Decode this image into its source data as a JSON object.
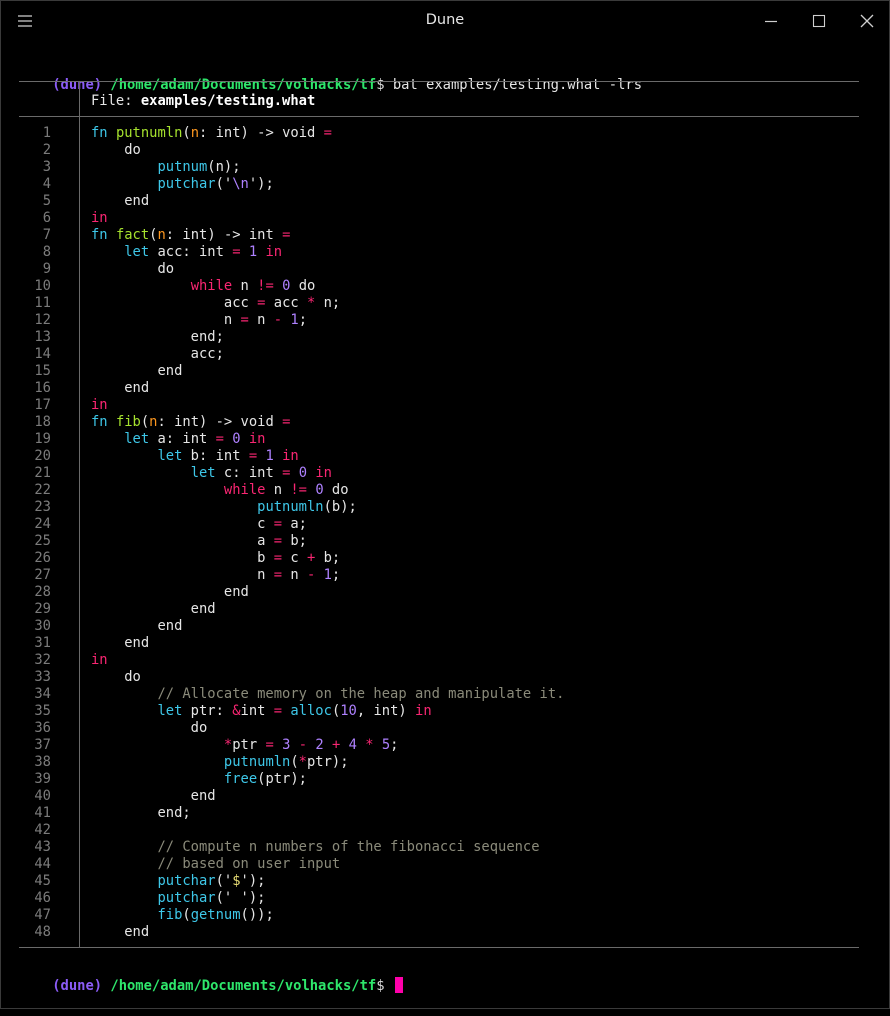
{
  "window": {
    "title": "Dune",
    "menu_icon": "hamburger-icon",
    "controls": [
      "minimize-icon",
      "maximize-icon",
      "close-icon"
    ]
  },
  "prompt": {
    "env": "(dune)",
    "path": "/home/adam/Documents/volhacks/tf",
    "symbol": "$",
    "command": "bat examples/testing.what -lrs"
  },
  "bat": {
    "file_label": "File: ",
    "file_name": "examples/testing.what"
  },
  "code_lines": [
    [
      [
        "fn",
        "k-fn"
      ],
      [
        " "
      ],
      [
        "putnumln",
        "k-name"
      ],
      [
        "("
      ],
      [
        "n",
        "k-param"
      ],
      [
        ": int) -> void "
      ],
      [
        "=",
        "k-op"
      ]
    ],
    [
      [
        "    do"
      ]
    ],
    [
      [
        "        "
      ],
      [
        "putnum",
        "k-call"
      ],
      [
        "(n);"
      ]
    ],
    [
      [
        "        "
      ],
      [
        "putchar",
        "k-call"
      ],
      [
        "('"
      ],
      [
        "\\n",
        "k-esc"
      ],
      [
        "');"
      ]
    ],
    [
      [
        "    end"
      ]
    ],
    [
      [
        "in",
        "k-op"
      ]
    ],
    [
      [
        "fn",
        "k-fn"
      ],
      [
        " "
      ],
      [
        "fact",
        "k-name"
      ],
      [
        "("
      ],
      [
        "n",
        "k-param"
      ],
      [
        ": int) -> int "
      ],
      [
        "=",
        "k-op"
      ]
    ],
    [
      [
        "    "
      ],
      [
        "let",
        "k-fn"
      ],
      [
        " acc: int "
      ],
      [
        "=",
        "k-op"
      ],
      [
        " "
      ],
      [
        "1",
        "k-num"
      ],
      [
        " "
      ],
      [
        "in",
        "k-op"
      ]
    ],
    [
      [
        "        do"
      ]
    ],
    [
      [
        "            "
      ],
      [
        "while",
        "k-op"
      ],
      [
        " n "
      ],
      [
        "!=",
        "k-op"
      ],
      [
        " "
      ],
      [
        "0",
        "k-num"
      ],
      [
        " do"
      ]
    ],
    [
      [
        "                acc "
      ],
      [
        "=",
        "k-op"
      ],
      [
        " acc "
      ],
      [
        "*",
        "k-op"
      ],
      [
        " n;"
      ]
    ],
    [
      [
        "                n "
      ],
      [
        "=",
        "k-op"
      ],
      [
        " n "
      ],
      [
        "-",
        "k-op"
      ],
      [
        " "
      ],
      [
        "1",
        "k-num"
      ],
      [
        ";"
      ]
    ],
    [
      [
        "            end;"
      ]
    ],
    [
      [
        "            acc;"
      ]
    ],
    [
      [
        "        end"
      ]
    ],
    [
      [
        "    end"
      ]
    ],
    [
      [
        "in",
        "k-op"
      ]
    ],
    [
      [
        "fn",
        "k-fn"
      ],
      [
        " "
      ],
      [
        "fib",
        "k-name"
      ],
      [
        "("
      ],
      [
        "n",
        "k-param"
      ],
      [
        ": int) -> void "
      ],
      [
        "=",
        "k-op"
      ]
    ],
    [
      [
        "    "
      ],
      [
        "let",
        "k-fn"
      ],
      [
        " a: int "
      ],
      [
        "=",
        "k-op"
      ],
      [
        " "
      ],
      [
        "0",
        "k-num"
      ],
      [
        " "
      ],
      [
        "in",
        "k-op"
      ]
    ],
    [
      [
        "        "
      ],
      [
        "let",
        "k-fn"
      ],
      [
        " b: int "
      ],
      [
        "=",
        "k-op"
      ],
      [
        " "
      ],
      [
        "1",
        "k-num"
      ],
      [
        " "
      ],
      [
        "in",
        "k-op"
      ]
    ],
    [
      [
        "            "
      ],
      [
        "let",
        "k-fn"
      ],
      [
        " c: int "
      ],
      [
        "=",
        "k-op"
      ],
      [
        " "
      ],
      [
        "0",
        "k-num"
      ],
      [
        " "
      ],
      [
        "in",
        "k-op"
      ]
    ],
    [
      [
        "                "
      ],
      [
        "while",
        "k-op"
      ],
      [
        " n "
      ],
      [
        "!=",
        "k-op"
      ],
      [
        " "
      ],
      [
        "0",
        "k-num"
      ],
      [
        " do"
      ]
    ],
    [
      [
        "                    "
      ],
      [
        "putnumln",
        "k-call"
      ],
      [
        "(b);"
      ]
    ],
    [
      [
        "                    c "
      ],
      [
        "=",
        "k-op"
      ],
      [
        " a;"
      ]
    ],
    [
      [
        "                    a "
      ],
      [
        "=",
        "k-op"
      ],
      [
        " b;"
      ]
    ],
    [
      [
        "                    b "
      ],
      [
        "=",
        "k-op"
      ],
      [
        " c "
      ],
      [
        "+",
        "k-op"
      ],
      [
        " b;"
      ]
    ],
    [
      [
        "                    n "
      ],
      [
        "=",
        "k-op"
      ],
      [
        " n "
      ],
      [
        "-",
        "k-op"
      ],
      [
        " "
      ],
      [
        "1",
        "k-num"
      ],
      [
        ";"
      ]
    ],
    [
      [
        "                end"
      ]
    ],
    [
      [
        "            end"
      ]
    ],
    [
      [
        "        end"
      ]
    ],
    [
      [
        "    end"
      ]
    ],
    [
      [
        "in",
        "k-op"
      ]
    ],
    [
      [
        "    do"
      ]
    ],
    [
      [
        "        "
      ],
      [
        "// Allocate memory on the heap and manipulate it.",
        "k-cm"
      ]
    ],
    [
      [
        "        "
      ],
      [
        "let",
        "k-fn"
      ],
      [
        " ptr: "
      ],
      [
        "&",
        "k-op"
      ],
      [
        "int "
      ],
      [
        "=",
        "k-op"
      ],
      [
        " "
      ],
      [
        "alloc",
        "k-call"
      ],
      [
        "("
      ],
      [
        "10",
        "k-num"
      ],
      [
        ", int) "
      ],
      [
        "in",
        "k-op"
      ]
    ],
    [
      [
        "            do"
      ]
    ],
    [
      [
        "                "
      ],
      [
        "*",
        "k-op"
      ],
      [
        "ptr "
      ],
      [
        "=",
        "k-op"
      ],
      [
        " "
      ],
      [
        "3",
        "k-num"
      ],
      [
        " "
      ],
      [
        "-",
        "k-op"
      ],
      [
        " "
      ],
      [
        "2",
        "k-num"
      ],
      [
        " "
      ],
      [
        "+",
        "k-op"
      ],
      [
        " "
      ],
      [
        "4",
        "k-num"
      ],
      [
        " "
      ],
      [
        "*",
        "k-op"
      ],
      [
        " "
      ],
      [
        "5",
        "k-num"
      ],
      [
        ";"
      ]
    ],
    [
      [
        "                "
      ],
      [
        "putnumln",
        "k-call"
      ],
      [
        "("
      ],
      [
        "*",
        "k-op"
      ],
      [
        "ptr);"
      ]
    ],
    [
      [
        "                "
      ],
      [
        "free",
        "k-call"
      ],
      [
        "(ptr);"
      ]
    ],
    [
      [
        "            end"
      ]
    ],
    [
      [
        "        end;"
      ]
    ],
    [
      [
        ""
      ]
    ],
    [
      [
        "        "
      ],
      [
        "// Compute n numbers of the fibonacci sequence",
        "k-cm"
      ]
    ],
    [
      [
        "        "
      ],
      [
        "// based on user input",
        "k-cm"
      ]
    ],
    [
      [
        "        "
      ],
      [
        "putchar",
        "k-call"
      ],
      [
        "('"
      ],
      [
        "$",
        "k-str"
      ],
      [
        "');"
      ]
    ],
    [
      [
        "        "
      ],
      [
        "putchar",
        "k-call"
      ],
      [
        "(' ');"
      ]
    ],
    [
      [
        "        "
      ],
      [
        "fib",
        "k-call"
      ],
      [
        "("
      ],
      [
        "getnum",
        "k-call"
      ],
      [
        "());"
      ]
    ],
    [
      [
        "    end"
      ]
    ]
  ],
  "line_numbers": [
    "1",
    "2",
    "3",
    "4",
    "5",
    "6",
    "7",
    "8",
    "9",
    "10",
    "11",
    "12",
    "13",
    "14",
    "15",
    "16",
    "17",
    "18",
    "19",
    "20",
    "21",
    "22",
    "23",
    "24",
    "25",
    "26",
    "27",
    "28",
    "29",
    "30",
    "31",
    "32",
    "33",
    "34",
    "35",
    "36",
    "37",
    "38",
    "39",
    "40",
    "41",
    "42",
    "43",
    "44",
    "45",
    "46",
    "47",
    "48"
  ]
}
